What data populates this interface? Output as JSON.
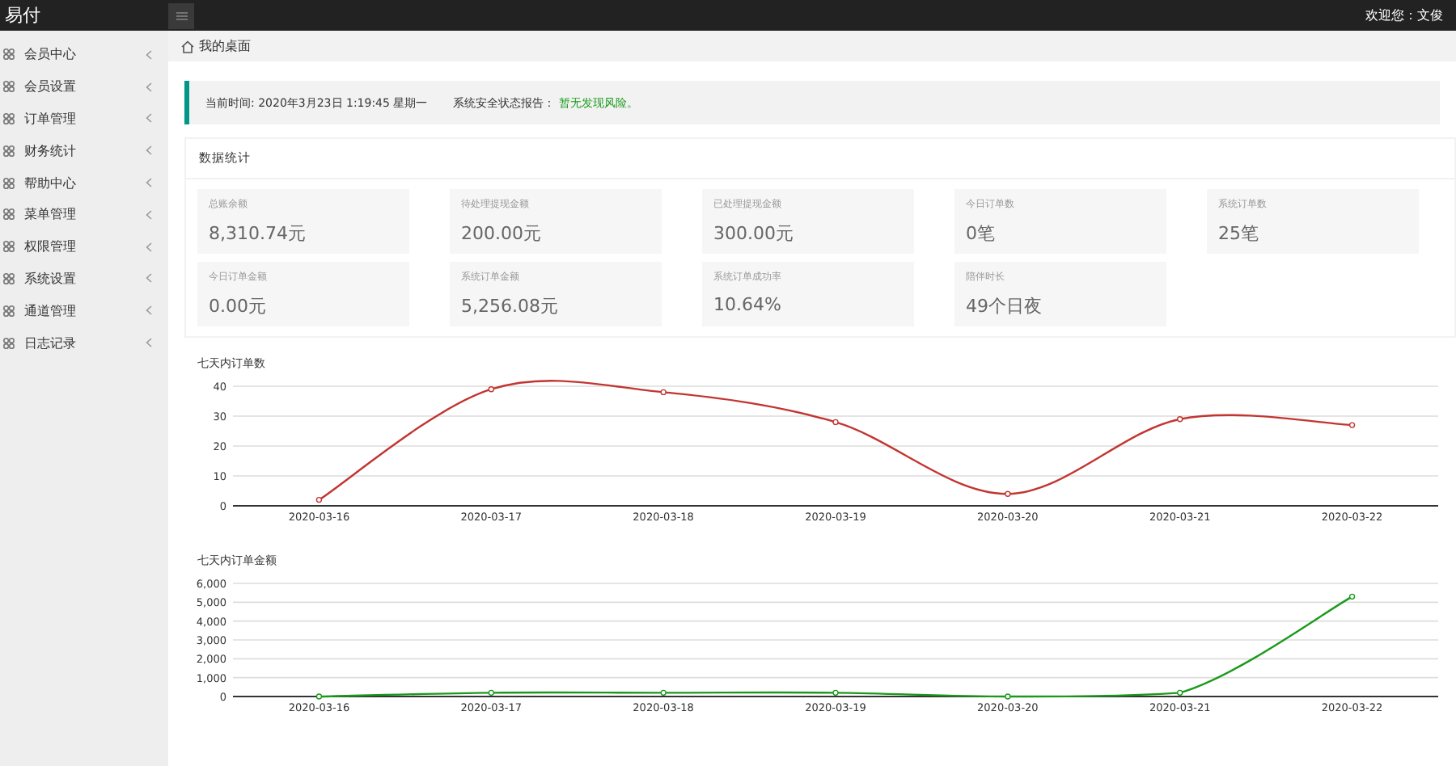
{
  "header": {
    "logo": "易付",
    "welcome": "欢迎您：文俊"
  },
  "sidebar": {
    "items": [
      {
        "label": "会员中心",
        "selected": false
      },
      {
        "label": "会员设置",
        "selected": false
      },
      {
        "label": "订单管理",
        "selected": false
      },
      {
        "label": "财务统计",
        "selected": false
      },
      {
        "label": "帮助中心",
        "selected": false
      },
      {
        "label": "菜单管理",
        "selected": false
      },
      {
        "label": "权限管理",
        "selected": false
      },
      {
        "label": "系统设置",
        "selected": false
      },
      {
        "label": "通道管理",
        "selected": false
      },
      {
        "label": "日志记录",
        "selected": false
      }
    ]
  },
  "breadcrumb": "我的桌面",
  "notice": {
    "time": "当前时间: 2020年3月23日 1:19:45 星期一",
    "status_label": "系统安全状态报告：",
    "status": "暂无发现风险。"
  },
  "stats": {
    "title": "数据统计",
    "cards": [
      {
        "label": "总账余额",
        "value": "8,310.74元"
      },
      {
        "label": "待处理提现金额",
        "value": "200.00元"
      },
      {
        "label": "已处理提现金额",
        "value": "300.00元"
      },
      {
        "label": "今日订单数",
        "value": "0笔"
      },
      {
        "label": "系统订单数",
        "value": "25笔"
      },
      {
        "label": "今日订单金额",
        "value": "0.00元"
      },
      {
        "label": "系统订单金额",
        "value": "5,256.08元"
      },
      {
        "label": "系统订单成功率",
        "value": "10.64%"
      },
      {
        "label": "陪伴时长",
        "value": "49个日夜"
      }
    ]
  },
  "charts": [
    {
      "chart_data": {
        "type": "line",
        "title": "七天内订单数",
        "categories": [
          "2020-03-16",
          "2020-03-17",
          "2020-03-18",
          "2020-03-19",
          "2020-03-20",
          "2020-03-21",
          "2020-03-22"
        ],
        "grid": true,
        "series": [
          {
            "color": "#c23531",
            "marker": true,
            "values": [
              2,
              39,
              38,
              28,
              4,
              29,
              27
            ]
          }
        ],
        "ylim": [
          0,
          40
        ],
        "yticks": [
          0,
          10,
          20,
          30,
          40
        ]
      }
    },
    {
      "chart_data": {
        "type": "line",
        "title": "七天内订单金额",
        "categories": [
          "2020-03-16",
          "2020-03-17",
          "2020-03-18",
          "2020-03-19",
          "2020-03-20",
          "2020-03-21",
          "2020-03-22"
        ],
        "grid": true,
        "series": [
          {
            "color": "#1a9a1a",
            "marker": true,
            "values": [
              0,
              200,
              200,
              200,
              0,
              200,
              5300
            ]
          }
        ],
        "ylim": [
          0,
          6000
        ],
        "yticks": [
          {
            "value": 0,
            "label": "0"
          },
          {
            "value": 1000,
            "label": "1,000"
          },
          {
            "value": 2000,
            "label": "2,000"
          },
          {
            "value": 3000,
            "label": "3,000"
          },
          {
            "value": 4000,
            "label": "4,000"
          },
          {
            "value": 5000,
            "label": "5,000"
          },
          {
            "value": 6000,
            "label": "6,000"
          }
        ]
      }
    }
  ]
}
